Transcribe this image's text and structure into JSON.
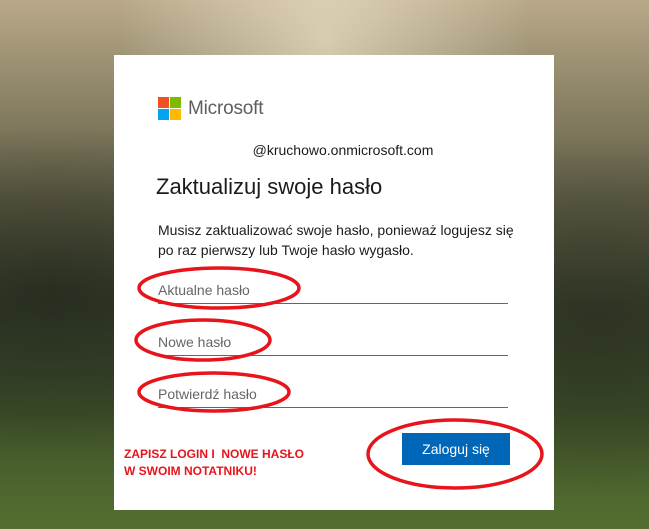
{
  "brand": {
    "name": "Microsoft",
    "logo_colors": [
      "#f25022",
      "#7fba00",
      "#00a4ef",
      "#ffb900"
    ]
  },
  "account": "@kruchowo.onmicrosoft.com",
  "page": {
    "title": "Zaktualizuj swoje hasło",
    "description": "Musisz zaktualizować swoje hasło, ponieważ logujesz się po raz pierwszy lub Twoje hasło wygasło."
  },
  "form": {
    "current_password_placeholder": "Aktualne hasło",
    "new_password_placeholder": "Nowe hasło",
    "confirm_password_placeholder": "Potwierdź hasło",
    "submit_label": "Zaloguj się"
  },
  "annotation": {
    "line1": "ZAPISZ LOGIN I  NOWE HASŁO",
    "line2": "W SWOIM NOTATNIKU!",
    "color": "#e8141c"
  },
  "colors": {
    "accent": "#0067b8"
  }
}
